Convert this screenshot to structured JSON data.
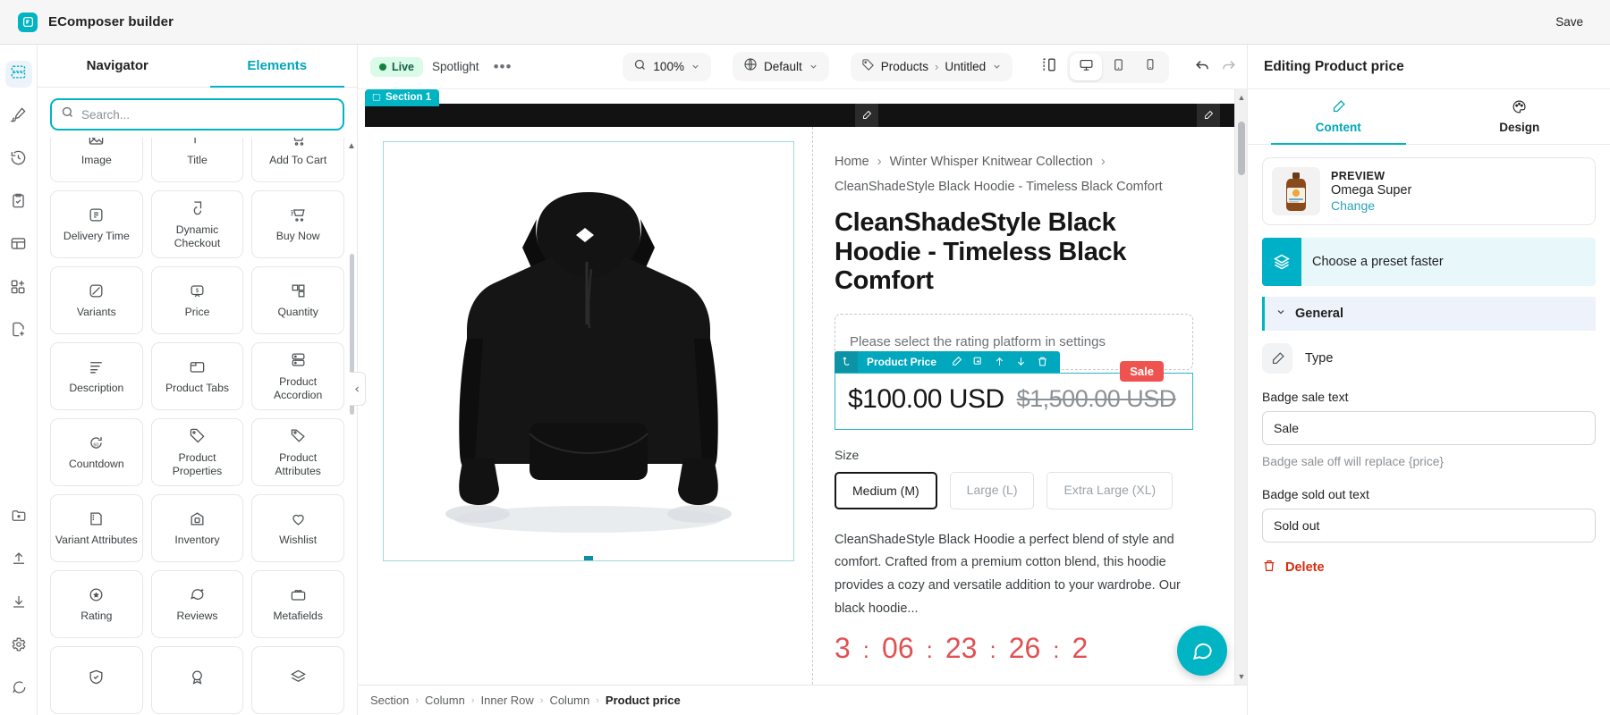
{
  "topbar": {
    "brand_title": "EComposer builder",
    "save_label": "Save"
  },
  "rail": {
    "items": [
      {
        "name": "sections-icon",
        "title": "Sections"
      },
      {
        "name": "brush-icon",
        "title": "Style"
      },
      {
        "name": "history-icon",
        "title": "History"
      },
      {
        "name": "clipboard-check-icon",
        "title": "Tasks"
      },
      {
        "name": "layout-icon",
        "title": "Layout"
      },
      {
        "name": "apps-add-icon",
        "title": "Apps"
      },
      {
        "name": "file-plus-icon",
        "title": "New page"
      }
    ],
    "bottom_items": [
      {
        "name": "folder-icon",
        "title": "Library"
      },
      {
        "name": "upload-icon",
        "title": "Import"
      },
      {
        "name": "download-icon",
        "title": "Export"
      },
      {
        "name": "gear-icon",
        "title": "Settings"
      },
      {
        "name": "chat-icon",
        "title": "Support"
      }
    ]
  },
  "left_panel": {
    "tabs": [
      {
        "label": "Navigator",
        "active": false
      },
      {
        "label": "Elements",
        "active": true
      }
    ],
    "search": {
      "value": "",
      "placeholder": "Search..."
    },
    "elements": [
      {
        "label": "Image",
        "icon": "image-icon"
      },
      {
        "label": "Title",
        "icon": "title-icon"
      },
      {
        "label": "Add To Cart",
        "icon": "cart-icon"
      },
      {
        "label": "Delivery Time",
        "icon": "delivery-time-icon"
      },
      {
        "label": "Dynamic Checkout",
        "icon": "dynamic-checkout-icon"
      },
      {
        "label": "Buy Now",
        "icon": "buy-now-icon"
      },
      {
        "label": "Variants",
        "icon": "variants-icon"
      },
      {
        "label": "Price",
        "icon": "price-icon"
      },
      {
        "label": "Quantity",
        "icon": "quantity-icon"
      },
      {
        "label": "Description",
        "icon": "description-icon"
      },
      {
        "label": "Product Tabs",
        "icon": "product-tabs-icon"
      },
      {
        "label": "Product Accordion",
        "icon": "product-accordion-icon"
      },
      {
        "label": "Countdown",
        "icon": "countdown-icon"
      },
      {
        "label": "Product Properties",
        "icon": "tag-icon"
      },
      {
        "label": "Product Attributes",
        "icon": "tag-alt-icon"
      },
      {
        "label": "Variant Attributes",
        "icon": "variant-attributes-icon"
      },
      {
        "label": "Inventory",
        "icon": "inventory-icon"
      },
      {
        "label": "Wishlist",
        "icon": "heart-icon"
      },
      {
        "label": "Rating",
        "icon": "star-circle-icon"
      },
      {
        "label": "Reviews",
        "icon": "review-icon"
      },
      {
        "label": "Metafields",
        "icon": "metafields-icon"
      },
      {
        "label": "",
        "icon": "shield-icon"
      },
      {
        "label": "",
        "icon": "badge-icon"
      },
      {
        "label": "",
        "icon": "layers-icon"
      }
    ]
  },
  "editor_toolbar": {
    "status_label": "Live",
    "spotlight_label": "Spotlight",
    "more_label": "•••",
    "zoom_value": "100%",
    "theme_value": "Default",
    "breadcrumb_root": "Products",
    "breadcrumb_page": "Untitled",
    "devices": [
      {
        "name": "responsive-icon",
        "active": false
      },
      {
        "name": "desktop-icon",
        "active": true
      },
      {
        "name": "tablet-icon",
        "active": false
      },
      {
        "name": "mobile-icon",
        "active": false
      }
    ],
    "undo_label": "Undo",
    "redo_label": "Redo"
  },
  "canvas": {
    "section_tag": "Section 1",
    "breadcrumbs": [
      "Home",
      "Winter Whisper Knitwear Collection",
      "CleanShadeStyle Black Hoodie - Timeless Black Comfort"
    ],
    "product_title": "CleanShadeStyle Black Hoodie - Timeless Black Comfort",
    "rating_placeholder": "Please select the rating platform in settings",
    "element_toolbar": {
      "label": "Product Price",
      "actions": [
        "edit-icon",
        "duplicate-icon",
        "move-up-icon",
        "move-down-icon",
        "delete-icon"
      ]
    },
    "price_current": "$100.00 USD",
    "price_compare": "$1,500.00 USD",
    "sale_badge": "Sale",
    "size_label": "Size",
    "sizes": [
      {
        "label": "Medium (M)",
        "selected": true
      },
      {
        "label": "Large (L)",
        "selected": false
      },
      {
        "label": "Extra Large (XL)",
        "selected": false
      }
    ],
    "description": "CleanShadeStyle Black Hoodie a perfect blend of style and comfort. Crafted from a premium cotton blend, this hoodie provides a cozy and versatile addition to your wardrobe. Our black hoodie...",
    "countdown": {
      "days": "3",
      "hours": "06",
      "minutes": "23",
      "seconds": "26",
      "extra": "2"
    }
  },
  "bottom_crumbs": [
    {
      "label": "Section",
      "active": false
    },
    {
      "label": "Column",
      "active": false
    },
    {
      "label": "Inner Row",
      "active": false
    },
    {
      "label": "Column",
      "active": false
    },
    {
      "label": "Product price",
      "active": true
    }
  ],
  "right_panel": {
    "header": "Editing Product price",
    "tabs": [
      {
        "label": "Content",
        "icon": "pencil-icon",
        "active": true
      },
      {
        "label": "Design",
        "icon": "palette-icon",
        "active": false
      }
    ],
    "preview": {
      "label": "PREVIEW",
      "product_name": "Omega Super",
      "change_label": "Change"
    },
    "preset_banner": "Choose a preset faster",
    "general_section": "General",
    "type_label": "Type",
    "badge_sale_label": "Badge sale text",
    "badge_sale_value": "Sale",
    "badge_sale_help": "Badge sale off will replace {price}",
    "badge_sold_out_label": "Badge sold out text",
    "badge_sold_out_value": "Sold out",
    "delete_label": "Delete"
  },
  "colors": {
    "accent": "#00b4c4",
    "sale_red": "#ef5350",
    "live_green": "#15803d",
    "delete_red": "#d82c0d"
  }
}
